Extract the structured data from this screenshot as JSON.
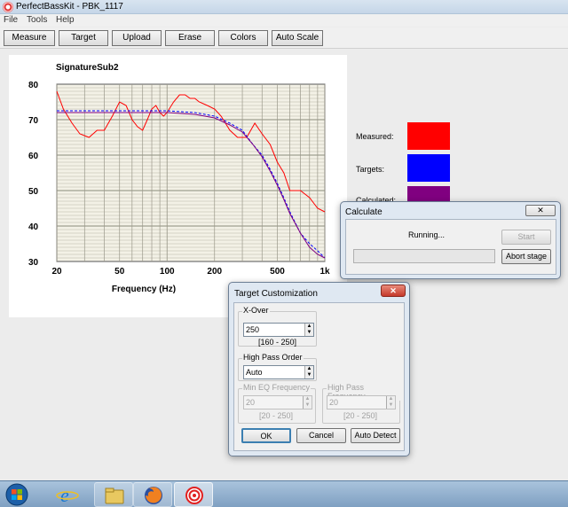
{
  "window": {
    "title": "PerfectBassKit - PBK_1117"
  },
  "menu": [
    "File",
    "Tools",
    "Help"
  ],
  "toolbar": [
    "Measure",
    "Target",
    "Upload",
    "Erase",
    "Colors",
    "Auto Scale"
  ],
  "chart_data": {
    "type": "line",
    "title": "SignatureSub2",
    "xlabel": "Frequency (Hz)",
    "ylabel": "",
    "x_scale": "log",
    "xlim": [
      20,
      1000
    ],
    "ylim": [
      30,
      80
    ],
    "xticks": [
      "20",
      "50",
      "100",
      "200",
      "500",
      "1k"
    ],
    "xtick_values": [
      20,
      50,
      100,
      200,
      500,
      1000
    ],
    "yticks": [
      "80",
      "70",
      "60",
      "50",
      "40",
      "30"
    ],
    "ytick_values": [
      80,
      70,
      60,
      50,
      40,
      30
    ],
    "grid": true,
    "series": [
      {
        "name": "Measured",
        "color": "#ff0000",
        "dash": false,
        "x": [
          20,
          22,
          25,
          28,
          32,
          36,
          40,
          45,
          50,
          55,
          60,
          65,
          70,
          75,
          80,
          85,
          90,
          95,
          100,
          110,
          120,
          130,
          140,
          150,
          160,
          180,
          200,
          220,
          250,
          280,
          320,
          360,
          400,
          450,
          500,
          550,
          600,
          650,
          700,
          800,
          900,
          1000
        ],
        "y": [
          78,
          73,
          69,
          66,
          65,
          67,
          67,
          71,
          75,
          74,
          70,
          68,
          67,
          70,
          73,
          74,
          72,
          71,
          72,
          75,
          77,
          77,
          76,
          76,
          75,
          74,
          73,
          71,
          67,
          65,
          65,
          69,
          66,
          63,
          58,
          55,
          50,
          50,
          50,
          48,
          45,
          44
        ]
      },
      {
        "name": "Targets",
        "color": "#0000ff",
        "dash": true,
        "x": [
          20,
          30,
          50,
          80,
          100,
          150,
          200,
          250,
          300,
          350,
          400,
          450,
          500,
          550,
          600,
          700,
          800,
          900,
          1000
        ],
        "y": [
          72.5,
          72.5,
          72.5,
          72.5,
          72.5,
          72,
          71,
          69,
          67,
          63,
          60,
          56,
          52,
          48,
          44,
          38,
          35,
          33,
          31
        ]
      },
      {
        "name": "Calculated",
        "color": "#800080",
        "dash": false,
        "x": [
          20,
          30,
          50,
          80,
          100,
          150,
          200,
          250,
          300,
          350,
          400,
          450,
          500,
          550,
          600,
          700,
          800,
          900,
          1000
        ],
        "y": [
          72,
          72,
          72,
          72,
          72,
          71.5,
          70.5,
          68.5,
          66.5,
          63,
          59.5,
          55.5,
          51.5,
          47.5,
          43.5,
          38,
          34,
          32,
          31
        ]
      }
    ]
  },
  "legend": [
    {
      "label": "Measured:",
      "color": "#ff0000"
    },
    {
      "label": "Targets:",
      "color": "#0000ff"
    },
    {
      "label": "Calculated:",
      "color": "#800080"
    }
  ],
  "calculate_dialog": {
    "title": "Calculate",
    "status": "Running...",
    "progress": 0,
    "start_label": "Start",
    "abort_label": "Abort stage"
  },
  "target_dialog": {
    "title": "Target Customization",
    "xover": {
      "label": "X-Over",
      "value": "250",
      "range": "[160 - 250]"
    },
    "hp_order": {
      "label": "High Pass Order",
      "value": "Auto"
    },
    "min_eq": {
      "label": "Min EQ Frequency",
      "value": "20",
      "range": "[20 - 250]"
    },
    "hp_freq": {
      "label": "High Pass Frequency",
      "value": "20",
      "range": "[20 - 250]"
    },
    "ok_label": "OK",
    "cancel_label": "Cancel",
    "auto_label": "Auto Detect"
  },
  "taskbar": {
    "items": [
      {
        "icon": "windows-start-icon"
      },
      {
        "icon": "internet-explorer-icon"
      },
      {
        "icon": "file-explorer-icon"
      },
      {
        "icon": "firefox-icon"
      },
      {
        "icon": "perfectbasskit-icon"
      }
    ]
  }
}
